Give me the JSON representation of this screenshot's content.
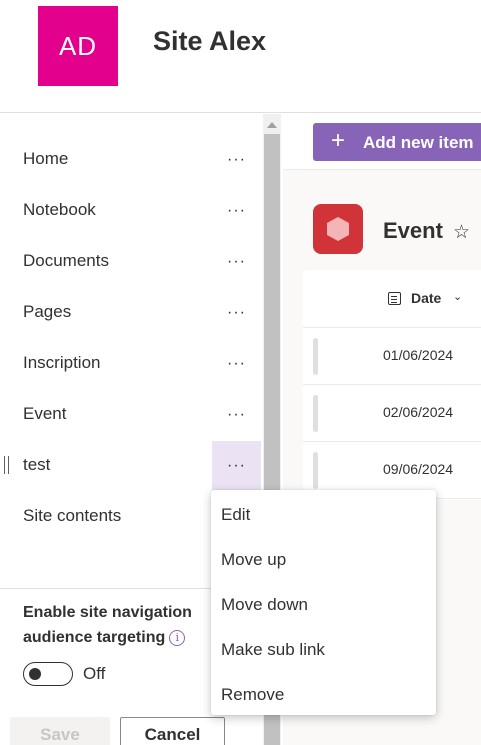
{
  "site": {
    "logo_initials": "AD",
    "logo_color": "#e3008c",
    "title": "Site Alex"
  },
  "nav": {
    "items": [
      {
        "label": "Home",
        "more": "···"
      },
      {
        "label": "Notebook",
        "more": "···"
      },
      {
        "label": "Documents",
        "more": "···"
      },
      {
        "label": "Pages",
        "more": "···"
      },
      {
        "label": "Inscription",
        "more": "···"
      },
      {
        "label": "Event",
        "more": "···"
      },
      {
        "label": "test",
        "more": "···",
        "selected": true
      },
      {
        "label": "Site contents"
      }
    ],
    "audience_targeting_label": "Enable site navigation audience targeting",
    "info_icon": "i",
    "toggle_state": "Off",
    "save_label": "Save",
    "cancel_label": "Cancel"
  },
  "context_menu": {
    "items": [
      "Edit",
      "Move up",
      "Move down",
      "Make sub link",
      "Remove"
    ]
  },
  "main": {
    "add_button": {
      "icon": "+",
      "label": "Add new item"
    },
    "list_title": "Event",
    "favorite_icon": "☆",
    "column": {
      "label": "Date",
      "chevron": "⌄"
    },
    "rows": [
      "01/06/2024",
      "02/06/2024",
      "09/06/2024"
    ]
  },
  "colors": {
    "accent": "#8764b8",
    "selected_bg": "#ebe3f3",
    "list_icon": "#d13438"
  }
}
